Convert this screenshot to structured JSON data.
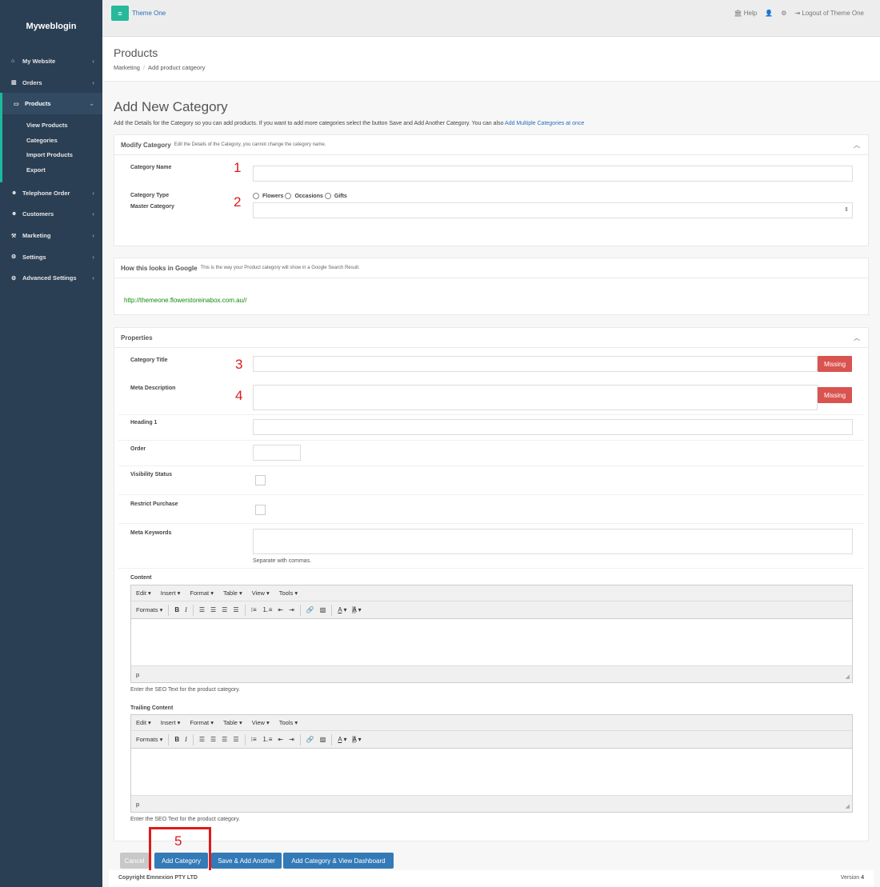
{
  "sidebar": {
    "brand": "Myweblogin",
    "items": [
      {
        "label": "My Website",
        "icon": "home-icon"
      },
      {
        "label": "Orders",
        "icon": "bar-chart-icon"
      },
      {
        "label": "Products",
        "icon": "desktop-icon"
      },
      {
        "label": "Telephone Order",
        "icon": "users-icon"
      },
      {
        "label": "Customers",
        "icon": "users-icon"
      },
      {
        "label": "Marketing",
        "icon": "wrench-icon"
      },
      {
        "label": "Settings",
        "icon": "gear-icon"
      },
      {
        "label": "Advanced Settings",
        "icon": "gears-icon"
      }
    ],
    "products_sub": [
      "View Products",
      "Categories",
      "Import Products",
      "Export"
    ]
  },
  "topbar": {
    "theme": "Theme One",
    "help": "Help",
    "logout": "Logout of Theme One"
  },
  "header": {
    "title": "Products",
    "breadcrumb": [
      "Marketing",
      "Add product catgeory"
    ]
  },
  "main": {
    "heading": "Add New Category",
    "description": "Add the Details for the Category so you can add products. If you want to add more categories select the button Save and Add Another Category. You can also",
    "description_link": "Add Multiple Categories at once"
  },
  "modify_panel": {
    "title": "Modify Category",
    "subtitle": "Edit the Details of the Category, you cannot change the category name.",
    "category_name_label": "Category Name",
    "category_type_label": "Category Type",
    "master_category_label": "Master Category",
    "radio_options": [
      "Flowers",
      "Occasions",
      "Gifts"
    ],
    "markers": [
      "1",
      "2"
    ]
  },
  "google_panel": {
    "title": "How this looks in Google",
    "subtitle": "This is the way your Product category will show in a Google Search Result.",
    "url": "http://themeone.flowerstoreinabox.com.au//"
  },
  "properties_panel": {
    "title": "Properties",
    "category_title_label": "Category Title",
    "meta_description_label": "Meta Description",
    "heading1_label": "Heading 1",
    "order_label": "Order",
    "visibility_label": "Visibility Status",
    "restrict_label": "Restrict Purchase",
    "meta_keywords_label": "Meta Keywords",
    "meta_keywords_help": "Separate with commas.",
    "missing": "Missing",
    "markers": [
      "3",
      "4"
    ],
    "content_label": "Content",
    "content_help": "Enter the SEO Text for the product category.",
    "trailing_label": "Trailing Content",
    "trailing_help": "Enter the SEO Text for the product category."
  },
  "editor": {
    "menus": [
      "Edit ▾",
      "Insert ▾",
      "Format ▾",
      "Table ▾",
      "View ▾",
      "Tools ▾"
    ],
    "formats": "Formats ▾",
    "status_path": "p"
  },
  "buttons": {
    "cancel": "Cancel",
    "add_category": "Add Category",
    "save_add_another": "Save & Add Another",
    "add_view_dashboard": "Add Category & View Dashboard",
    "marker": "5"
  },
  "footer": {
    "copyright": "Copyright Emnexion PTY LTD",
    "version_label": "Version",
    "version": "4"
  }
}
